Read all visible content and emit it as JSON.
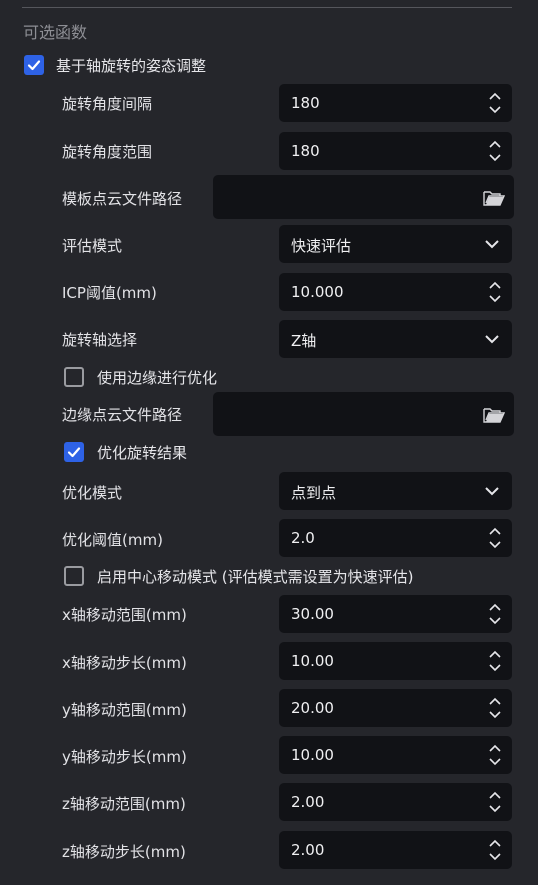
{
  "section_title": "可选函数",
  "main_checkbox": {
    "label": "基于轴旋转的姿态调整",
    "checked": true
  },
  "fields": {
    "rot_interval": {
      "label": "旋转角度间隔",
      "value": "180"
    },
    "rot_range": {
      "label": "旋转角度范围",
      "value": "180"
    },
    "template_path": {
      "label": "模板点云文件路径",
      "value": ""
    },
    "eval_mode": {
      "label": "评估模式",
      "value": "快速评估"
    },
    "icp_threshold": {
      "label": "ICP阈值(mm)",
      "value": "10.000"
    },
    "rot_axis": {
      "label": "旋转轴选择",
      "value": "Z轴"
    },
    "use_edge": {
      "label": "使用边缘进行优化",
      "checked": false
    },
    "edge_path": {
      "label": "边缘点云文件路径",
      "value": ""
    },
    "optimize_result": {
      "label": "优化旋转结果",
      "checked": true
    },
    "opt_mode": {
      "label": "优化模式",
      "value": "点到点"
    },
    "opt_threshold": {
      "label": "优化阈值(mm)",
      "value": "2.0"
    },
    "center_move": {
      "label": "启用中心移动模式 (评估模式需设置为快速评估)",
      "checked": false
    },
    "x_range": {
      "label": "x轴移动范围(mm)",
      "value": "30.00"
    },
    "x_step": {
      "label": "x轴移动步长(mm)",
      "value": "10.00"
    },
    "y_range": {
      "label": "y轴移动范围(mm)",
      "value": "20.00"
    },
    "y_step": {
      "label": "y轴移动步长(mm)",
      "value": "10.00"
    },
    "z_range": {
      "label": "z轴移动范围(mm)",
      "value": "2.00"
    },
    "z_step": {
      "label": "z轴移动步长(mm)",
      "value": "2.00"
    }
  },
  "icons": {
    "checkbox_check": "checkmark-icon",
    "spin": "spin-arrows-icon",
    "dropdown": "chevron-down-icon",
    "folder": "folder-open-icon"
  },
  "colors": {
    "background": "#25262b",
    "input_bg": "#111216",
    "accent": "#2e62e6",
    "text": "#e2e2e6",
    "muted": "#8d8e94"
  }
}
